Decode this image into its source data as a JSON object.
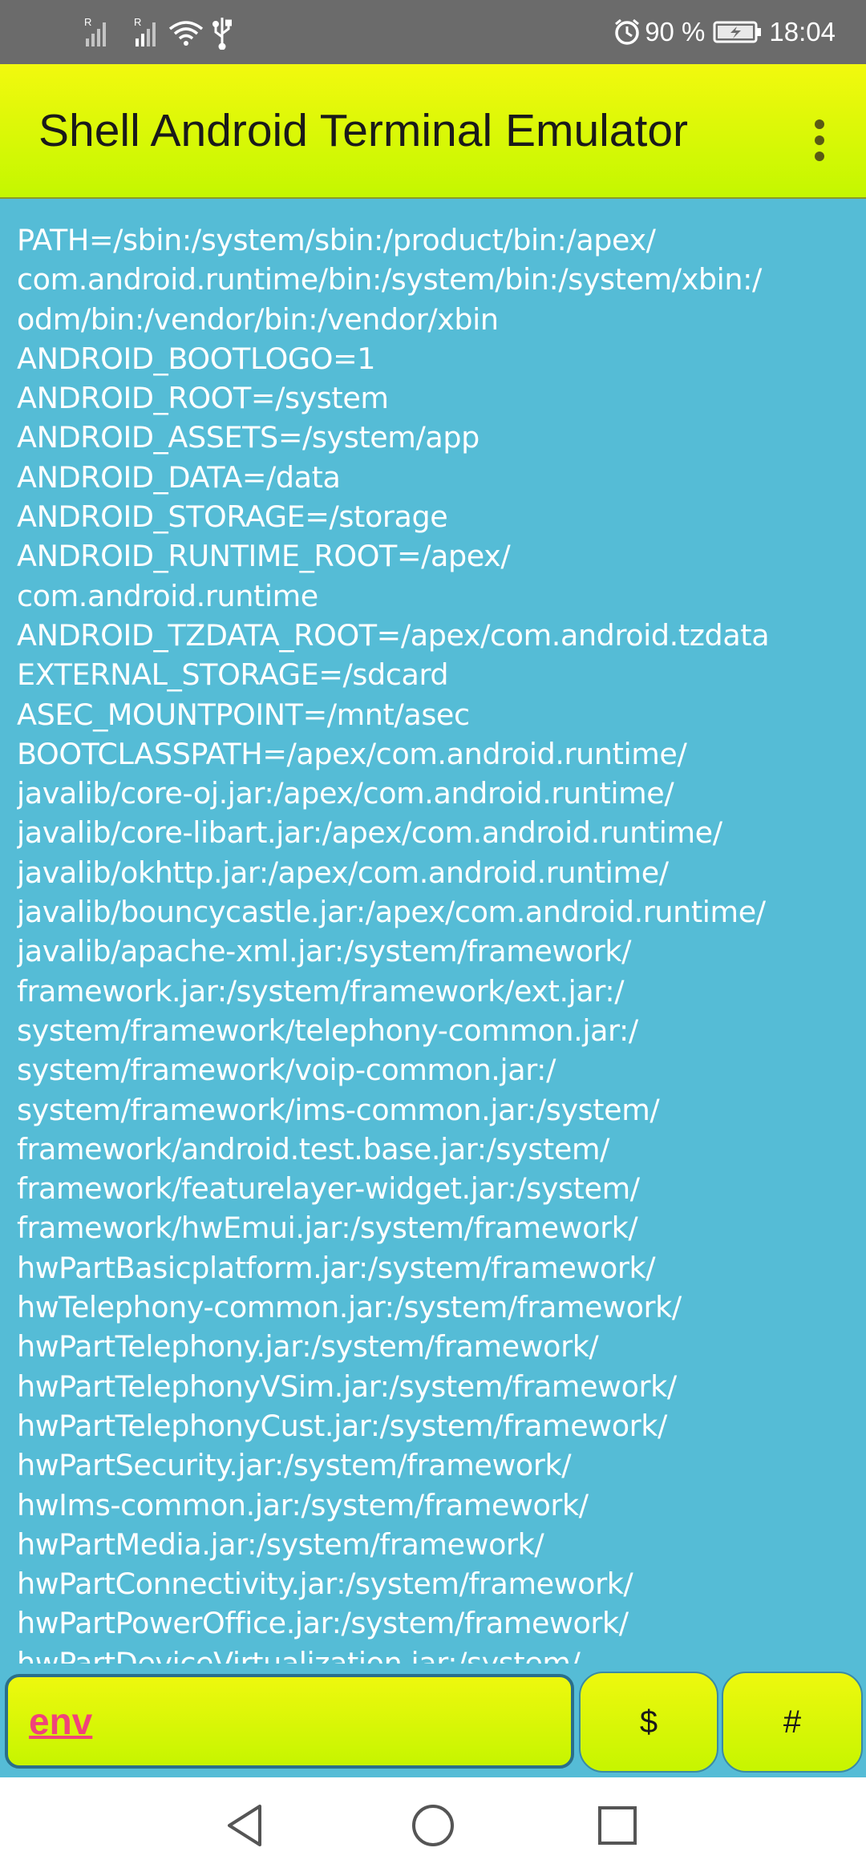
{
  "status_bar": {
    "battery_percent": "90 %",
    "time": "18:04",
    "icons": [
      "signal-r-icon",
      "signal-r-icon",
      "wifi-icon",
      "usb-icon",
      "alarm-icon",
      "battery-charging-icon"
    ]
  },
  "app_bar": {
    "title": "Shell Android Terminal Emulator",
    "menu_icon": "overflow-menu-icon"
  },
  "terminal": {
    "lines": [
      "PATH=/sbin:/system/sbin:/product/bin:/apex/",
      "com.android.runtime/bin:/system/bin:/system/xbin:/",
      "odm/bin:/vendor/bin:/vendor/xbin",
      "ANDROID_BOOTLOGO=1",
      "ANDROID_ROOT=/system",
      "ANDROID_ASSETS=/system/app",
      "ANDROID_DATA=/data",
      "ANDROID_STORAGE=/storage",
      "ANDROID_RUNTIME_ROOT=/apex/",
      "com.android.runtime",
      "ANDROID_TZDATA_ROOT=/apex/com.android.tzdata",
      "EXTERNAL_STORAGE=/sdcard",
      "ASEC_MOUNTPOINT=/mnt/asec",
      "BOOTCLASSPATH=/apex/com.android.runtime/",
      "javalib/core-oj.jar:/apex/com.android.runtime/",
      "javalib/core-libart.jar:/apex/com.android.runtime/",
      "javalib/okhttp.jar:/apex/com.android.runtime/",
      "javalib/bouncycastle.jar:/apex/com.android.runtime/",
      "javalib/apache-xml.jar:/system/framework/",
      "framework.jar:/system/framework/ext.jar:/",
      "system/framework/telephony-common.jar:/",
      "system/framework/voip-common.jar:/",
      "system/framework/ims-common.jar:/system/",
      "framework/android.test.base.jar:/system/",
      "framework/featurelayer-widget.jar:/system/",
      "framework/hwEmui.jar:/system/framework/",
      "hwPartBasicplatform.jar:/system/framework/",
      "hwTelephony-common.jar:/system/framework/",
      "hwPartTelephony.jar:/system/framework/",
      "hwPartTelephonyVSim.jar:/system/framework/",
      "hwPartTelephonyCust.jar:/system/framework/",
      "hwPartSecurity.jar:/system/framework/",
      "hwIms-common.jar:/system/framework/",
      "hwPartMedia.jar:/system/framework/",
      "hwPartConnectivity.jar:/system/framework/",
      "hwPartPowerOffice.jar:/system/framework/",
      "hwPartDeviceVirtualization.jar:/system/"
    ]
  },
  "input_bar": {
    "command_value": "env",
    "dollar_button": "$",
    "hash_button": "#"
  },
  "nav_bar": {
    "icons": [
      "back-icon",
      "home-icon",
      "recents-icon"
    ]
  },
  "colors": {
    "terminal_background": "#55bcd6",
    "accent_yellow": "#e6f80a",
    "command_text": "#f0437a"
  }
}
